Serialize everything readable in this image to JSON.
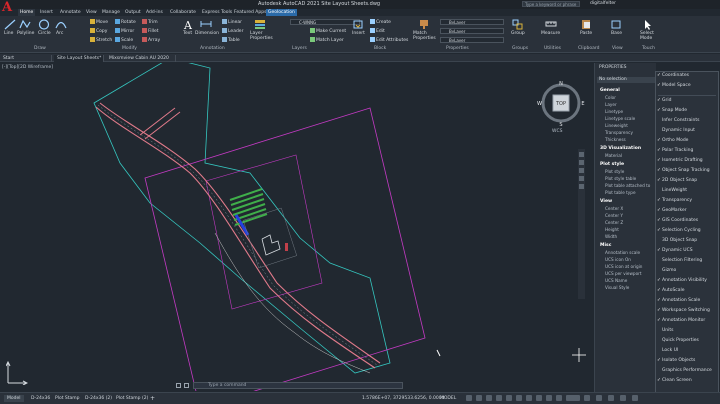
{
  "app": {
    "title": "Autodesk AutoCAD 2021   Site Layout Sheets.dwg",
    "search_placeholder": "Type a keyword or phrase",
    "user": "digitalfelter"
  },
  "menu_tabs": [
    "Home",
    "Insert",
    "Annotate",
    "View",
    "Manage",
    "Output",
    "Add-ins",
    "Collaborate",
    "Express Tools",
    "Featured Apps",
    "Geolocation"
  ],
  "ribbon": {
    "draw": {
      "line": "Line",
      "polyline": "Polyline",
      "circle": "Circle",
      "arc": "Arc",
      "label": "Draw"
    },
    "modify": {
      "move": "Move",
      "rotate": "Rotate",
      "trim": "Trim",
      "copy": "Copy",
      "mirror": "Mirror",
      "fillet": "Fillet",
      "stretch": "Stretch",
      "scale": "Scale",
      "array": "Array",
      "label": "Modify"
    },
    "annotation": {
      "text": "Text",
      "dimension": "Dimension",
      "linear": "Linear",
      "leader": "Leader",
      "table": "Table",
      "label": "Annotation"
    },
    "layers": {
      "layer_properties": "Layer Properties",
      "layer_value": "C-WNNG",
      "make_current": "Make Current",
      "match_layer": "Match Layer",
      "label": "Layers"
    },
    "block": {
      "insert": "Insert",
      "create": "Create",
      "edit": "Edit",
      "edit_attributes": "Edit Attributes",
      "label": "Block"
    },
    "properties": {
      "match": "Match Properties",
      "bylayer1": "ByLayer",
      "bylayer2": "ByLayer",
      "bylayer3": "ByLayer",
      "label": "Properties"
    },
    "groups": {
      "group": "Group",
      "label": "Groups"
    },
    "utilities": {
      "measure": "Measure",
      "label": "Utilities"
    },
    "clipboard": {
      "paste": "Paste",
      "label": "Clipboard"
    },
    "view": {
      "base": "Base",
      "label": "View"
    },
    "select": {
      "select_mode": "Select Mode"
    },
    "touch": {
      "label": "Touch"
    }
  },
  "doc_tabs": [
    "Start",
    "Site Layout Sheets*",
    "Mixsmview Cabin AU 2020"
  ],
  "viewport": {
    "label": "[-][Top][2D Wireframe]",
    "cube_top": "TOP",
    "n": "N",
    "s": "S",
    "e": "E",
    "w": "W",
    "wcs": "WCS"
  },
  "command_placeholder": "Type a command",
  "properties": {
    "title": "PROPERTIES",
    "selection": "No selection",
    "sections": [
      {
        "name": "General",
        "items": [
          "Color",
          "Layer",
          "Linetype",
          "Linetype scale",
          "Lineweight",
          "Transparency",
          "Thickness"
        ]
      },
      {
        "name": "3D Visualization",
        "items": [
          "Material"
        ]
      },
      {
        "name": "Plot style",
        "items": [
          "Plot style",
          "Plot style table",
          "Plot table attached to",
          "Plot table type"
        ]
      },
      {
        "name": "View",
        "items": [
          "Center X",
          "Center Y",
          "Center Z",
          "Height",
          "Width"
        ]
      },
      {
        "name": "Misc",
        "items": [
          "Annotation scale",
          "UCS icon On",
          "UCS icon at origin",
          "UCS per viewport",
          "UCS Name",
          "Visual Style"
        ]
      }
    ]
  },
  "customization_menu": [
    {
      "label": "Coordinates",
      "checked": true
    },
    {
      "label": "Model Space",
      "checked": true
    },
    {
      "sep": true
    },
    {
      "label": "Grid",
      "checked": true
    },
    {
      "label": "Snap Mode",
      "checked": true
    },
    {
      "label": "Infer Constraints",
      "checked": false
    },
    {
      "label": "Dynamic Input",
      "checked": false
    },
    {
      "label": "Ortho Mode",
      "checked": true
    },
    {
      "label": "Polar Tracking",
      "checked": true
    },
    {
      "label": "Isometric Drafting",
      "checked": true
    },
    {
      "label": "Object Snap Tracking",
      "checked": true
    },
    {
      "label": "2D Object Snap",
      "checked": true
    },
    {
      "label": "LineWeight",
      "checked": false
    },
    {
      "label": "Transparency",
      "checked": true
    },
    {
      "label": "GeoMarker",
      "checked": true
    },
    {
      "label": "GIS Coordinates",
      "checked": true
    },
    {
      "label": "Selection Cycling",
      "checked": true
    },
    {
      "label": "3D Object Snap",
      "checked": false
    },
    {
      "label": "Dynamic UCS",
      "checked": true
    },
    {
      "label": "Selection Filtering",
      "checked": false
    },
    {
      "label": "Gizmo",
      "checked": false
    },
    {
      "label": "Annotation Visibility",
      "checked": true
    },
    {
      "label": "AutoScale",
      "checked": true
    },
    {
      "label": "Annotation Scale",
      "checked": true
    },
    {
      "label": "Workspace Switching",
      "checked": true
    },
    {
      "label": "Annotation Monitor",
      "checked": true
    },
    {
      "label": "Units",
      "checked": false
    },
    {
      "label": "Quick Properties",
      "checked": false
    },
    {
      "label": "Lock UI",
      "checked": false
    },
    {
      "label": "Isolate Objects",
      "checked": true
    },
    {
      "label": "Graphics Performance",
      "checked": false
    },
    {
      "label": "Clean Screen",
      "checked": true
    }
  ],
  "status": {
    "layout_tabs": [
      "Model",
      "D-24x36",
      "Plot Stamp",
      "D-24x36 (2)",
      "Plot Stamp (2)"
    ],
    "coords": "1.5786E+07, 3729533.6256, 0.0000",
    "model": "MODEL"
  },
  "colors": {
    "accent": "#2a6aa8",
    "road": "#e07a8a",
    "boundary_cyan": "#35c7c0",
    "boundary_magenta": "#c43ac4",
    "building_green": "#3fae4a",
    "highlight_blue": "#2440e0"
  }
}
